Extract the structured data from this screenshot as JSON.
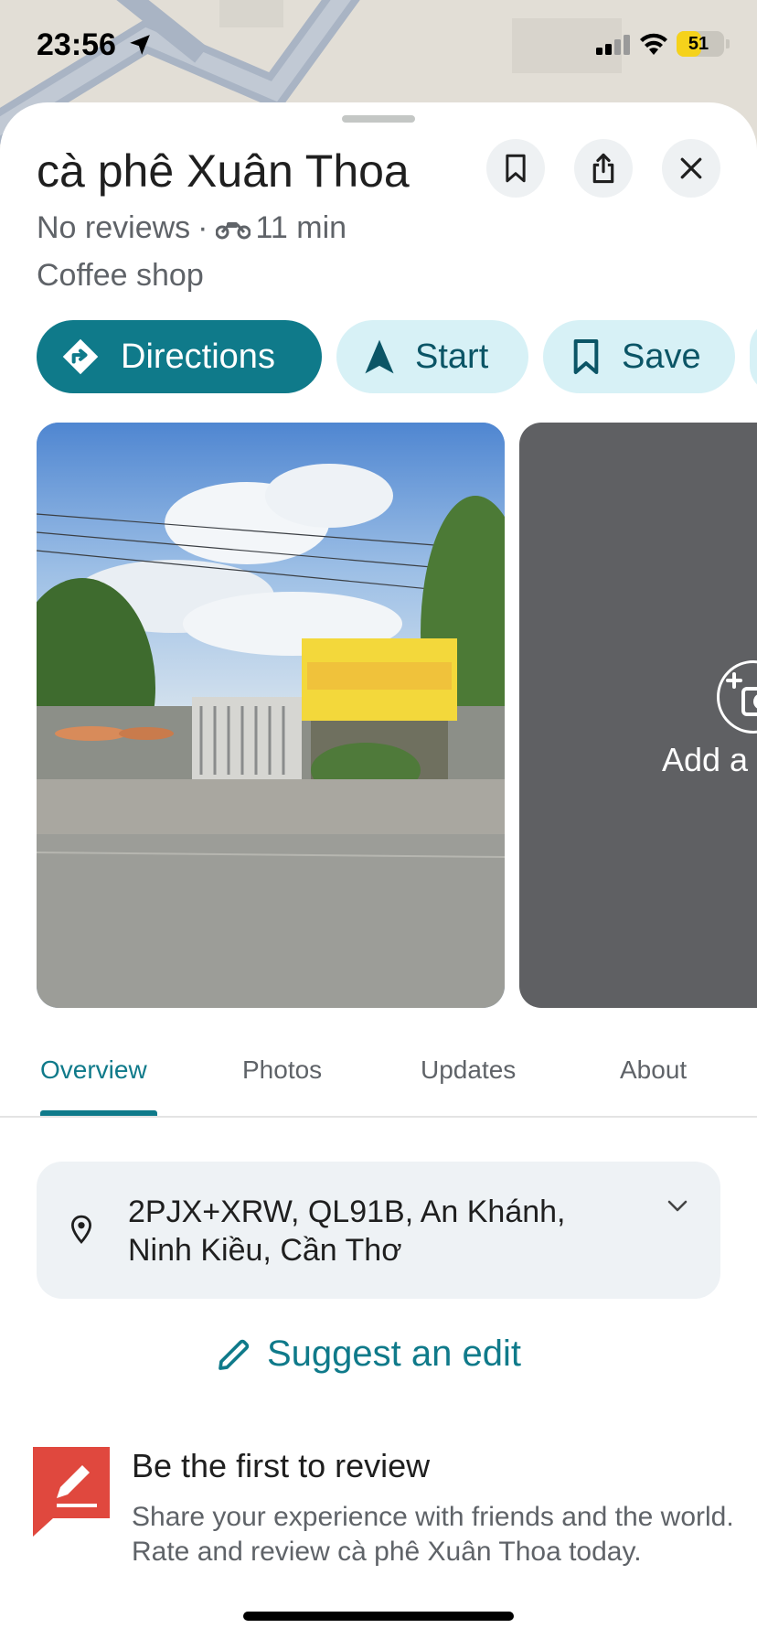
{
  "status_bar": {
    "time": "23:56",
    "battery": "51",
    "battery_level": 0.51
  },
  "place": {
    "name": "cà phê Xuân Thoa",
    "reviews": "No reviews",
    "separator": "·",
    "travel_time": "11 min",
    "category": "Coffee shop"
  },
  "actions": {
    "directions": "Directions",
    "start": "Start",
    "save": "Save"
  },
  "photos": {
    "add_label": "Add a"
  },
  "tabs": [
    "Overview",
    "Photos",
    "Updates",
    "About"
  ],
  "address": {
    "line1": "2PJX+XRW, QL91B, An Khánh,",
    "line2": "Ninh Kiều, Cần Thơ"
  },
  "suggest_edit": "Suggest an edit",
  "review_prompt": {
    "title": "Be the first to review",
    "body": "Share your experience with friends and the world. Rate and review cà phê Xuân Thoa today."
  },
  "colors": {
    "accent": "#0f7a8a",
    "chip_secondary_bg": "#d7f1f6",
    "review_icon": "#e0483e",
    "battery": "#f5d21b"
  }
}
